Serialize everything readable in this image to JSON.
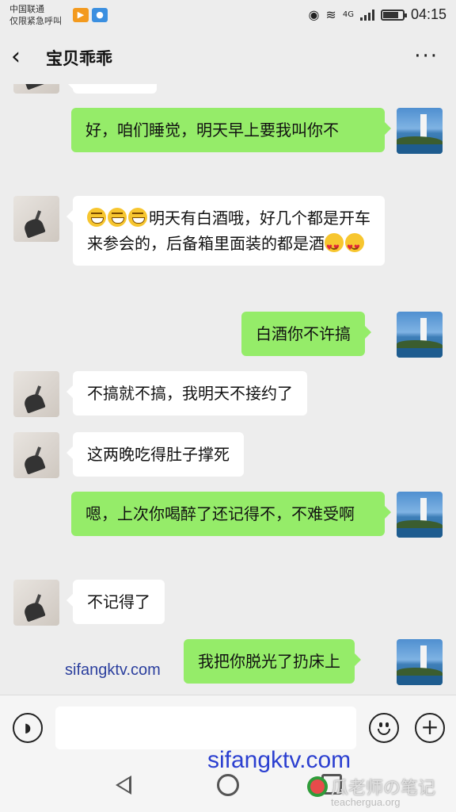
{
  "status_bar": {
    "carrier_line1": "中国联通",
    "carrier_line2": "仅限紧急呼叫",
    "network": "4G",
    "time": "04:15",
    "battery_level": 0.8
  },
  "nav": {
    "back_icon": "chevron-left-icon",
    "title": "宝贝乖乖",
    "more_icon": "more-dots-icon"
  },
  "messages": [
    {
      "side": "right",
      "text": "好，咱们睡觉，明天早上要我叫你不"
    },
    {
      "side": "left",
      "emoji_prefix": [
        "grin",
        "grin",
        "grin"
      ],
      "text": "明天有白酒哦，好几个都是开车来参会的，后备箱里面装的都是酒",
      "emoji_suffix": [
        "heart-eyes",
        "heart-eyes"
      ]
    },
    {
      "side": "right",
      "text": "白酒你不许搞"
    },
    {
      "side": "left",
      "text": "不搞就不搞，我明天不接约了"
    },
    {
      "side": "left",
      "text": "这两晚吃得肚子撑死"
    },
    {
      "side": "right",
      "text": "嗯，上次你喝醉了还记得不，不难受啊"
    },
    {
      "side": "left",
      "text": "不记得了"
    },
    {
      "side": "right",
      "text": "我把你脱光了扔床上"
    }
  ],
  "watermarks": {
    "chat_overlay": "sifangktv.com",
    "bottom_overlay": "sifangktv.com",
    "logo_name": "瓜老师の笔记",
    "logo_site": "teachergua.org"
  },
  "input_bar": {
    "voice_icon": "voice-icon",
    "text_value": "",
    "emoji_icon": "emoji-icon",
    "plus_icon": "plus-icon"
  },
  "colors": {
    "sent_bubble": "#95ec69",
    "received_bubble": "#ffffff",
    "background": "#ededed"
  }
}
